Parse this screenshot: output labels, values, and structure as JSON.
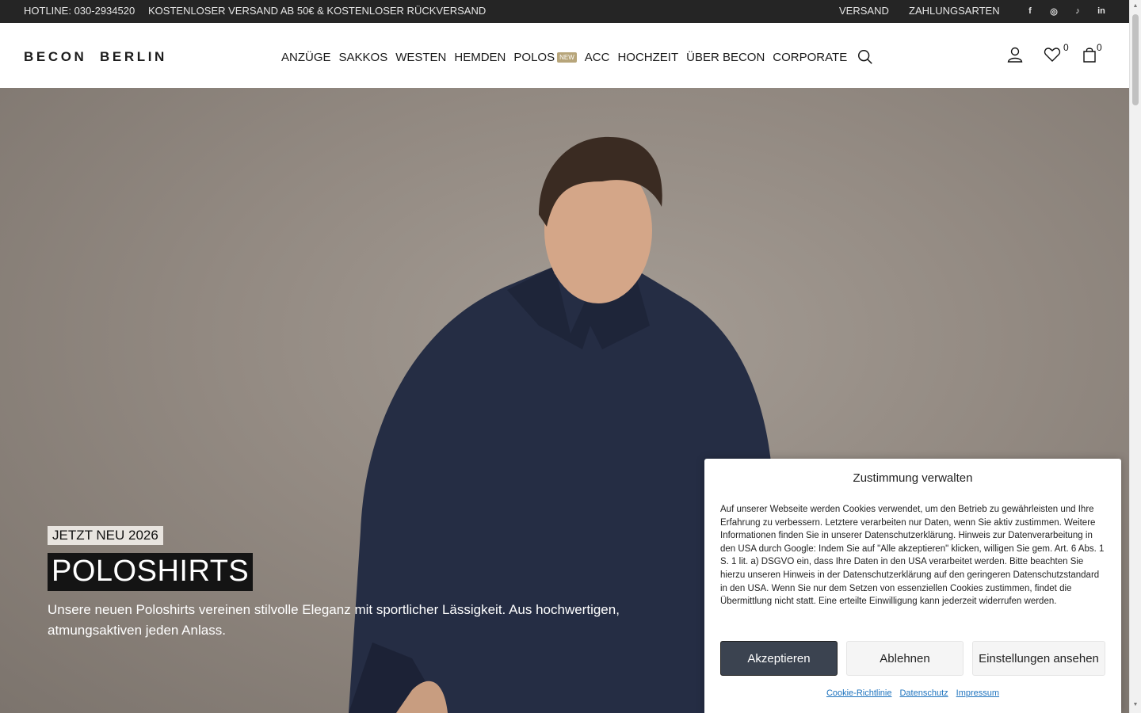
{
  "topbar": {
    "hotline": "HOTLINE: 030-2934520",
    "shipping": "KOSTENLOSER VERSAND AB 50€ & KOSTENLOSER RÜCKVERSAND",
    "links": [
      "VERSAND",
      "ZAHLUNGSARTEN"
    ],
    "social_icons": [
      "facebook-icon",
      "instagram-icon",
      "tiktok-icon",
      "linkedin-icon"
    ],
    "social_glyphs": {
      "facebook": "f",
      "instagram": "◎",
      "tiktok": "♪",
      "linkedin": "in"
    }
  },
  "header": {
    "logo": "BECON  BERLIN",
    "nav": [
      "ANZÜGE",
      "SAKKOS",
      "WESTEN",
      "HEMDEN",
      "POLOS",
      "ACC",
      "HOCHZEIT",
      "ÜBER BECON",
      "CORPORATE"
    ],
    "polos_badge": "NEW",
    "wishlist_count": "0",
    "cart_count": "0"
  },
  "hero": {
    "eyebrow": "JETZT NEU 2026",
    "title": "POLOSHIRTS",
    "text": "Unsere neuen Poloshirts vereinen stilvolle Eleganz mit sportlicher Lässigkeit. Aus hochwertigen, atmungsaktiven jeden Anlass."
  },
  "cookie": {
    "title": "Zustimmung verwalten",
    "text": "Auf unserer Webseite werden Cookies verwendet, um den Betrieb zu gewährleisten und Ihre Erfahrung zu verbessern. Letztere verarbeiten nur Daten, wenn Sie aktiv zustimmen. Weitere Informationen finden Sie in unserer Datenschutzerklärung. Hinweis zur Datenverarbeitung in den USA durch Google: Indem Sie auf \"Alle akzeptieren\" klicken, willigen Sie gem. Art. 6 Abs. 1 S. 1 lit. a) DSGVO ein, dass Ihre Daten in den USA verarbeitet werden. Bitte beachten Sie hierzu unseren Hinweis in der Datenschutzerklärung auf den geringeren Datenschutzstandard in den USA. Wenn Sie nur dem Setzen von essenziellen Cookies zustimmen, findet die Übermittlung nicht statt. Eine erteilte Einwilligung kann jederzeit widerrufen werden.",
    "accept": "Akzeptieren",
    "decline": "Ablehnen",
    "settings": "Einstellungen ansehen",
    "links": [
      "Cookie-Richtlinie",
      "Datenschutz",
      "Impressum"
    ]
  },
  "colors": {
    "topbar_bg": "#252525",
    "accent_badge": "#b7a57a",
    "primary_button": "#3b4350",
    "link": "#1e73be",
    "shirt": "#252d44"
  }
}
